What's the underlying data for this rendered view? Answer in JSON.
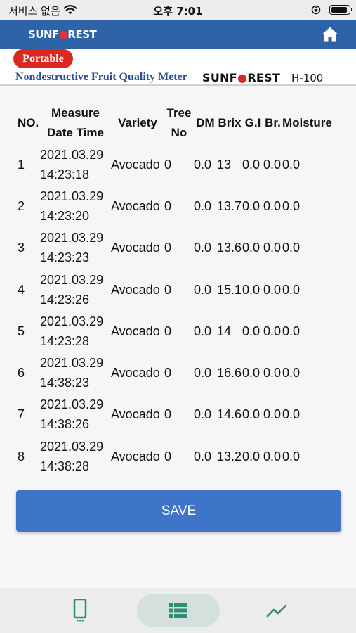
{
  "status_bar": {
    "carrier": "서비스 없음",
    "time": "오후 7:01"
  },
  "app_bar": {
    "brand_prefix": "SUNF",
    "brand_flame": "●",
    "brand_suffix": "REST",
    "home_icon": "home-icon"
  },
  "banner": {
    "badge": "Portable",
    "product": "Nondestructive Fruit Quality Meter",
    "maker_prefix": "SUNF",
    "maker_flame": "●",
    "maker_suffix": "REST",
    "model": "H-100"
  },
  "table": {
    "headers": {
      "no": "NO.",
      "date_1": "Measure",
      "date_2": "Date Time",
      "variety": "Variety",
      "tree_1": "Tree",
      "tree_2": "No",
      "dm": "DM",
      "brix": "Brix",
      "gi": "G.I",
      "br": "Br.",
      "moisture": "Moisture"
    },
    "rows": [
      {
        "no": "1",
        "date": "2021.03.29",
        "time": "14:23:18",
        "variety": "Avocado",
        "tree": "0",
        "dm": "0.0",
        "brix": "13",
        "gi": "0.0",
        "br": "0.0",
        "moisture": "0.0"
      },
      {
        "no": "2",
        "date": "2021.03.29",
        "time": "14:23:20",
        "variety": "Avocado",
        "tree": "0",
        "dm": "0.0",
        "brix": "13.7",
        "gi": "0.0",
        "br": "0.0",
        "moisture": "0.0"
      },
      {
        "no": "3",
        "date": "2021.03.29",
        "time": "14:23:23",
        "variety": "Avocado",
        "tree": "0",
        "dm": "0.0",
        "brix": "13.6",
        "gi": "0.0",
        "br": "0.0",
        "moisture": "0.0"
      },
      {
        "no": "4",
        "date": "2021.03.29",
        "time": "14:23:26",
        "variety": "Avocado",
        "tree": "0",
        "dm": "0.0",
        "brix": "15.1",
        "gi": "0.0",
        "br": "0.0",
        "moisture": "0.0"
      },
      {
        "no": "5",
        "date": "2021.03.29",
        "time": "14:23:28",
        "variety": "Avocado",
        "tree": "0",
        "dm": "0.0",
        "brix": "14",
        "gi": "0.0",
        "br": "0.0",
        "moisture": "0.0"
      },
      {
        "no": "6",
        "date": "2021.03.29",
        "time": "14:38:23",
        "variety": "Avocado",
        "tree": "0",
        "dm": "0.0",
        "brix": "16.6",
        "gi": "0.0",
        "br": "0.0",
        "moisture": "0.0"
      },
      {
        "no": "7",
        "date": "2021.03.29",
        "time": "14:38:26",
        "variety": "Avocado",
        "tree": "0",
        "dm": "0.0",
        "brix": "14.6",
        "gi": "0.0",
        "br": "0.0",
        "moisture": "0.0"
      },
      {
        "no": "8",
        "date": "2021.03.29",
        "time": "14:38:28",
        "variety": "Avocado",
        "tree": "0",
        "dm": "0.0",
        "brix": "13.2",
        "gi": "0.0",
        "br": "0.0",
        "moisture": "0.0"
      }
    ]
  },
  "save_label": "SAVE",
  "bottom_nav": {
    "items": [
      {
        "icon": "device-icon",
        "selected": false
      },
      {
        "icon": "list-icon",
        "selected": true
      },
      {
        "icon": "chart-icon",
        "selected": false
      }
    ]
  },
  "colors": {
    "app_bar": "#2e63a8",
    "badge": "#d8281f",
    "button": "#3f75c9",
    "nav_icon": "#2f8c76",
    "nav_selected": "#d3e0dc"
  }
}
